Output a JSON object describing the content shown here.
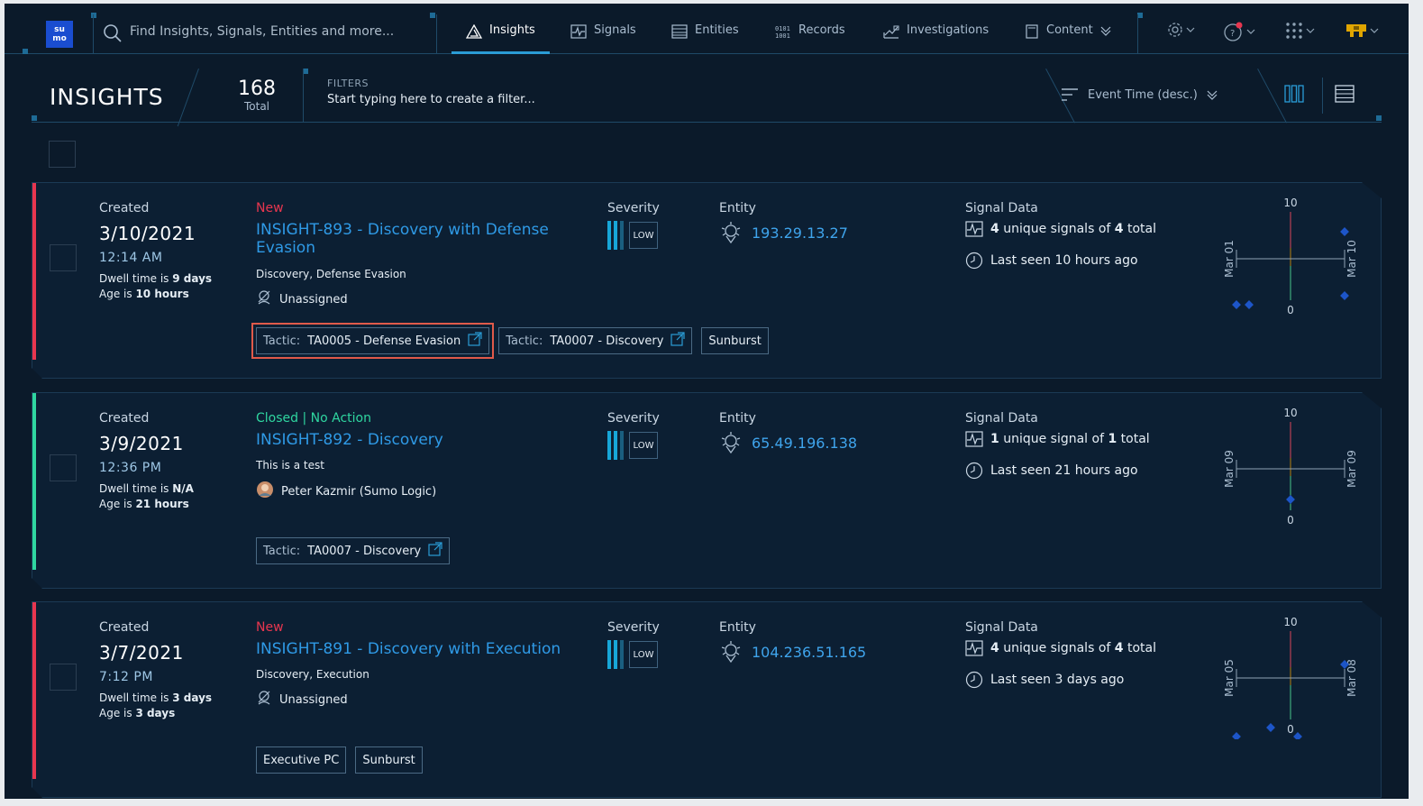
{
  "nav": {
    "logo_top": "su",
    "logo_bottom": "mo",
    "search_placeholder": "Find Insights, Signals, Entities and more...",
    "tabs": [
      {
        "label": "Insights",
        "icon": "insights-icon"
      },
      {
        "label": "Signals",
        "icon": "signals-icon"
      },
      {
        "label": "Entities",
        "icon": "entities-icon"
      },
      {
        "label": "Records",
        "icon": "records-icon"
      },
      {
        "label": "Investigations",
        "icon": "investigations-icon"
      },
      {
        "label": "Content",
        "icon": "content-icon"
      }
    ],
    "active_tab": "Insights"
  },
  "header": {
    "title": "INSIGHTS",
    "count": "168",
    "count_label": "Total",
    "filters_label": "FILTERS",
    "filters_hint": "Start typing here to create a filter...",
    "sort_label": "Event Time (desc.)"
  },
  "labels": {
    "created": "Created",
    "severity": "Severity",
    "entity": "Entity",
    "signal_data": "Signal Data",
    "dwell_prefix": "Dwell time is ",
    "age_prefix": "Age is "
  },
  "insights": [
    {
      "status": "New",
      "status_color": "#e8364f",
      "stripe_color": "#e8364f",
      "date": "3/10/2021",
      "time": "12:14 AM",
      "dwell": "9 days",
      "age": "10 hours",
      "name": "INSIGHT-893 - Discovery with Defense Evasion",
      "tactics": "Discovery, Defense Evasion",
      "assignee": "Unassigned",
      "severity": "LOW",
      "entity": "193.29.13.27",
      "signals_unique": "4",
      "signals_mid": " unique signals of ",
      "signals_total": "4",
      "signals_suffix": " total",
      "last_seen": "Last seen 10 hours ago",
      "spark": {
        "top": "10",
        "bottom": "0",
        "left": "Mar 01",
        "right": "Mar 10"
      },
      "tags": [
        {
          "key": "Tactic: ",
          "value": "TA0005 - Defense Evasion",
          "external": true,
          "highlight": true
        },
        {
          "key": "Tactic: ",
          "value": "TA0007 - Discovery",
          "external": true,
          "highlight": false
        },
        {
          "key": "",
          "value": "Sunburst",
          "external": false,
          "highlight": false
        }
      ]
    },
    {
      "status": "Closed | No Action",
      "status_color": "#2fd6a0",
      "stripe_color": "#2fd6a0",
      "date": "3/9/2021",
      "time": "12:36 PM",
      "dwell": "N/A",
      "age": "21 hours",
      "name": "INSIGHT-892 - Discovery",
      "tactics": "This is a test",
      "assignee": "Peter Kazmir (Sumo Logic)",
      "severity": "LOW",
      "entity": "65.49.196.138",
      "signals_unique": "1",
      "signals_mid": " unique signal of ",
      "signals_total": "1",
      "signals_suffix": " total",
      "last_seen": "Last seen 21 hours ago",
      "spark": {
        "top": "10",
        "bottom": "0",
        "left": "Mar 09",
        "right": "Mar 09"
      },
      "tags": [
        {
          "key": "Tactic: ",
          "value": "TA0007 - Discovery",
          "external": true,
          "highlight": false
        }
      ]
    },
    {
      "status": "New",
      "status_color": "#e8364f",
      "stripe_color": "#e8364f",
      "date": "3/7/2021",
      "time": "7:12 PM",
      "dwell": "3 days",
      "age": "3 days",
      "name": "INSIGHT-891 - Discovery with Execution",
      "tactics": "Discovery, Execution",
      "assignee": "Unassigned",
      "severity": "LOW",
      "entity": "104.236.51.165",
      "signals_unique": "4",
      "signals_mid": " unique signals of ",
      "signals_total": "4",
      "signals_suffix": " total",
      "last_seen": "Last seen 3 days ago",
      "spark": {
        "top": "10",
        "bottom": "0",
        "left": "Mar 05",
        "right": "Mar 08"
      },
      "tags": [
        {
          "key": "",
          "value": "Executive PC",
          "external": false,
          "highlight": false
        },
        {
          "key": "",
          "value": "Sunburst",
          "external": false,
          "highlight": false
        }
      ]
    }
  ]
}
